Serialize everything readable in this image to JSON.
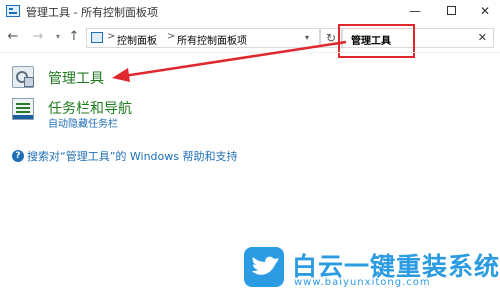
{
  "window": {
    "title": "管理工具 - 所有控制面板项",
    "minimize_glyph": "—",
    "close_glyph": "✕"
  },
  "nav": {
    "back_glyph": "←",
    "forward_glyph": "→",
    "recent_glyph": "▾",
    "up_glyph": "↑",
    "refresh_glyph": "↻"
  },
  "address": {
    "separator": ">",
    "breadcrumbs": [
      "控制面板",
      "所有控制面板项"
    ],
    "dropdown_glyph": "▾"
  },
  "search": {
    "value": "管理工具",
    "clear_glyph": "✕"
  },
  "results": [
    {
      "title": "管理工具",
      "icon": "admin-tools-icon"
    },
    {
      "title": "任务栏和导航",
      "subtitle": "自动隐藏任务栏",
      "icon": "taskbar-icon"
    }
  ],
  "help": {
    "link_text": "搜索对“管理工具”的 Windows 帮助和支持",
    "icon_glyph": "?"
  },
  "watermark": {
    "title": "白云一键重装系统",
    "url": "www.baiyunxitong.com"
  },
  "colors": {
    "accent": "#1f6fb5",
    "result_title": "#1e7a1e",
    "highlight": "#e0272d",
    "watermark": "#2b9be2"
  }
}
